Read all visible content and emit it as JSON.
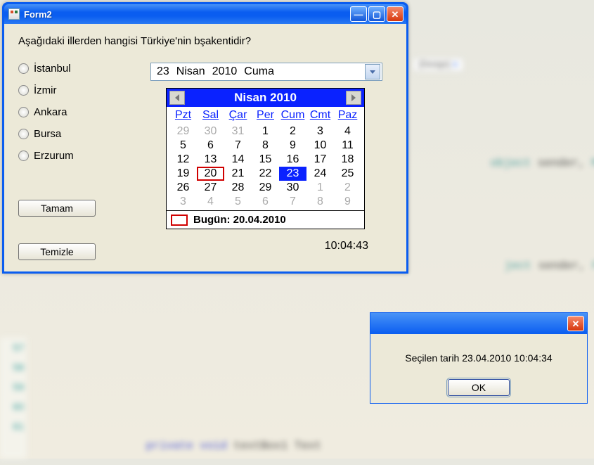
{
  "bg": {
    "tab_label": "[Design]",
    "line_numbers": [
      "57",
      "58",
      "59",
      "60",
      "61"
    ],
    "snippet1_pre": "object ",
    "snippet1_kw": "sender, ",
    "snippet1_post": "Mo",
    "snippet2_pre": "ject ",
    "snippet2_kw": "sender, ",
    "snippet2_post": "Form",
    "bottom_code_pre": "private void",
    "bottom_code_mid": " textBox1 ",
    "bottom_code_post": "Text"
  },
  "window": {
    "title": "Form2",
    "question": "Aşağıdaki illerden hangisi Türkiye'nin bşakentidir?",
    "radios": [
      "İstanbul",
      "İzmir",
      "Ankara",
      "Bursa",
      "Erzurum"
    ],
    "btn_ok": "Tamam",
    "btn_clear": "Temizle",
    "timestamp": "10:04:43"
  },
  "datepicker": {
    "day": "23",
    "month": "Nisan",
    "year": "2010",
    "dow": "Cuma"
  },
  "calendar": {
    "title": "Nisan 2010",
    "dow": [
      "Pzt",
      "Sal",
      "Çar",
      "Per",
      "Cum",
      "Cmt",
      "Paz"
    ],
    "weeks": [
      [
        {
          "v": "29",
          "dim": true
        },
        {
          "v": "30",
          "dim": true
        },
        {
          "v": "31",
          "dim": true
        },
        {
          "v": "1"
        },
        {
          "v": "2"
        },
        {
          "v": "3"
        },
        {
          "v": "4"
        }
      ],
      [
        {
          "v": "5"
        },
        {
          "v": "6"
        },
        {
          "v": "7"
        },
        {
          "v": "8"
        },
        {
          "v": "9"
        },
        {
          "v": "10"
        },
        {
          "v": "11"
        }
      ],
      [
        {
          "v": "12"
        },
        {
          "v": "13"
        },
        {
          "v": "14"
        },
        {
          "v": "15"
        },
        {
          "v": "16"
        },
        {
          "v": "17"
        },
        {
          "v": "18"
        }
      ],
      [
        {
          "v": "19"
        },
        {
          "v": "20",
          "today": true
        },
        {
          "v": "21"
        },
        {
          "v": "22"
        },
        {
          "v": "23",
          "sel": true
        },
        {
          "v": "24"
        },
        {
          "v": "25"
        }
      ],
      [
        {
          "v": "26"
        },
        {
          "v": "27"
        },
        {
          "v": "28"
        },
        {
          "v": "29"
        },
        {
          "v": "30"
        },
        {
          "v": "1",
          "dim": true
        },
        {
          "v": "2",
          "dim": true
        }
      ],
      [
        {
          "v": "3",
          "dim": true
        },
        {
          "v": "4",
          "dim": true
        },
        {
          "v": "5",
          "dim": true
        },
        {
          "v": "6",
          "dim": true
        },
        {
          "v": "7",
          "dim": true
        },
        {
          "v": "8",
          "dim": true
        },
        {
          "v": "9",
          "dim": true
        }
      ]
    ],
    "today_label": "Bugün: 20.04.2010"
  },
  "msgbox": {
    "text": "Seçilen tarih 23.04.2010 10:04:34",
    "ok": "OK"
  }
}
